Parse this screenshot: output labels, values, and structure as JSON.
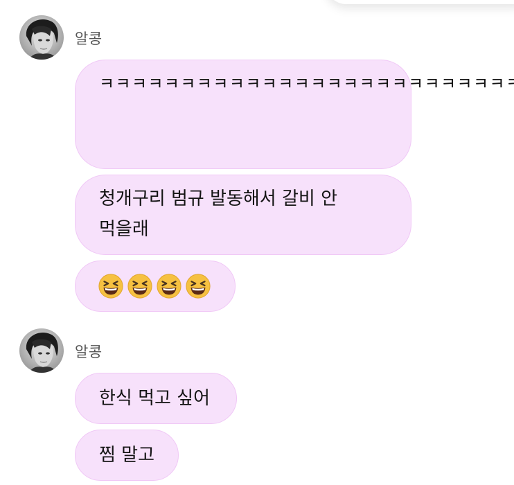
{
  "groups": [
    {
      "sender": "알콩",
      "messages": [
        {
          "text": "ㅋㅋㅋㅋㅋㅋㅋㅋㅋㅋㅋㅋㅋㅋㅋㅋㅋㅋㅋㅋㅋㅋㅋㅋㅋㅋㅋㅋㅋㅋㅋㅋㅋㅋㅋㅋㅋㅋㅋㅋㅋㅋㅋ갈비!??"
        },
        {
          "text": "청개구리 범규 발동해서 갈비 안 먹을래"
        },
        {
          "emoji": [
            "grinning-squinting-face",
            "grinning-squinting-face",
            "grinning-squinting-face",
            "grinning-squinting-face"
          ]
        }
      ]
    },
    {
      "sender": "알콩",
      "messages": [
        {
          "text": "한식 먹고 싶어"
        },
        {
          "text": "찜 말고"
        }
      ]
    }
  ],
  "colors": {
    "bubble_bg": "#f7e1fb",
    "bubble_border": "#f0c8f6",
    "text": "#141414",
    "sender": "#555555"
  }
}
